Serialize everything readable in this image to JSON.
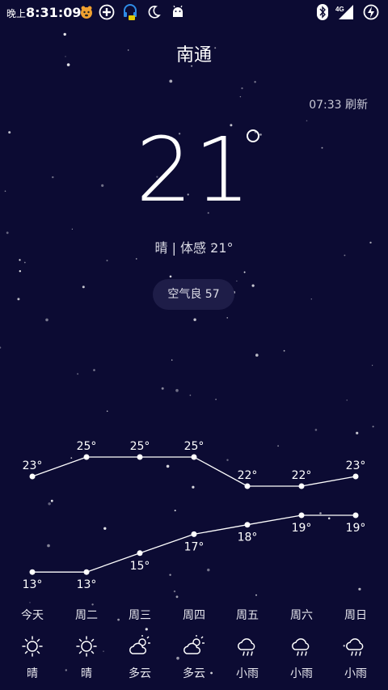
{
  "status_bar": {
    "time_prefix": "晚上",
    "time": "8:31:09",
    "network": "4G"
  },
  "header": {
    "city": "南通",
    "refresh": "07:33 刷新"
  },
  "current": {
    "temperature": "21",
    "description": "晴 | 体感 21°",
    "air_quality": "空气良 57"
  },
  "forecast": {
    "days": [
      "今天",
      "周二",
      "周三",
      "周四",
      "周五",
      "周六",
      "周日"
    ],
    "high": [
      23,
      25,
      25,
      25,
      22,
      22,
      23
    ],
    "low": [
      13,
      13,
      15,
      17,
      18,
      19,
      19
    ],
    "high_labels": [
      "23°",
      "25°",
      "25°",
      "25°",
      "22°",
      "22°",
      "23°"
    ],
    "low_labels": [
      "13°",
      "13°",
      "15°",
      "17°",
      "18°",
      "19°",
      "19°"
    ],
    "conditions": [
      "晴",
      "晴",
      "多云",
      "多云",
      "小雨",
      "小雨",
      "小雨"
    ],
    "icons": [
      "sun-icon",
      "sun-icon",
      "partly-cloudy-icon",
      "partly-cloudy-icon",
      "rain-icon",
      "rain-icon",
      "rain-icon"
    ]
  }
}
